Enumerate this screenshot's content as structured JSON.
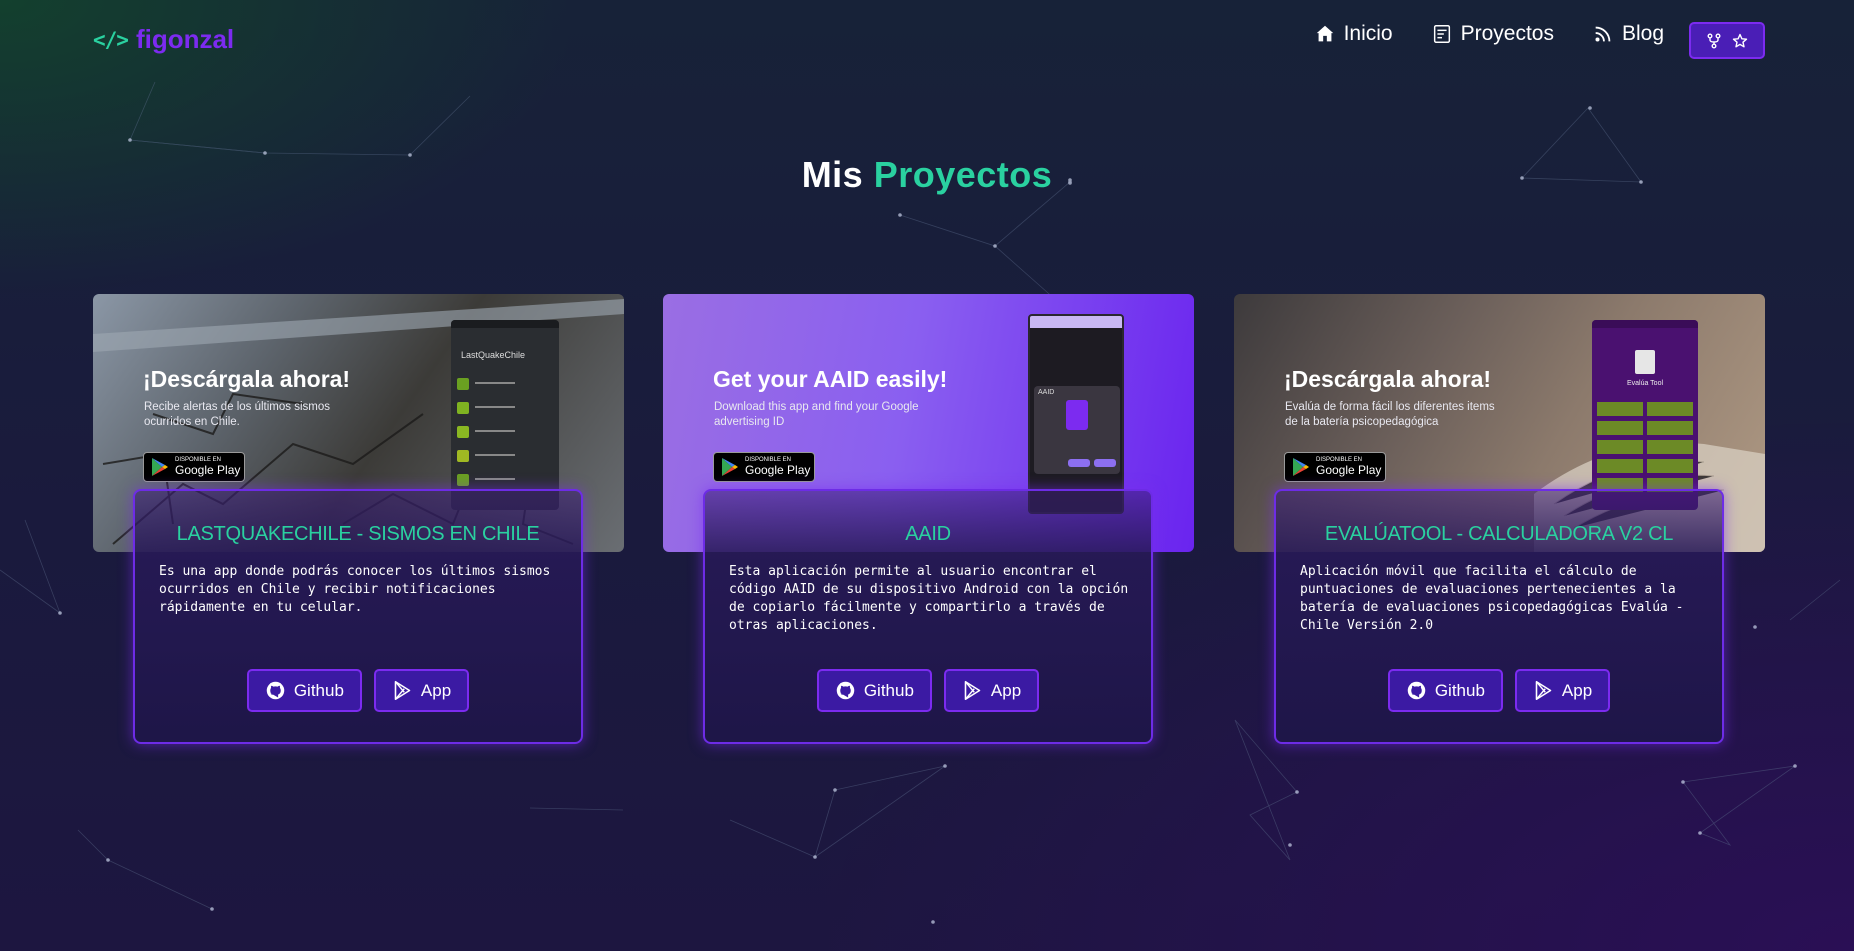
{
  "nav": {
    "logo_icon": "</>",
    "logo_text": "figonzal",
    "links": [
      {
        "label": "Inicio",
        "icon": "home-icon"
      },
      {
        "label": "Proyectos",
        "icon": "projects-icon"
      },
      {
        "label": "Blog",
        "icon": "rss-icon"
      }
    ],
    "repo_button_icons": [
      "fork-icon",
      "star-icon"
    ]
  },
  "page": {
    "title_part1": "Mis",
    "title_part2": "Proyectos"
  },
  "colors": {
    "accent_green": "#2ad1a0",
    "accent_purple": "#7c2bf0",
    "button_bg": "#3b1aa3"
  },
  "projects": [
    {
      "banner_headline": "¡Descárgala ahora!",
      "banner_sub": "Recibe alertas de los últimos sismos ocurridos en Chile.",
      "badge_small": "DISPONIBLE EN",
      "badge_big": "Google Play",
      "phone_app_title": "LastQuakeChile",
      "title": "LASTQUAKECHILE - SISMOS EN CHILE",
      "description": "Es una app donde podrás conocer los últimos sismos ocurridos en Chile y recibir notificaciones rápidamente en tu celular.",
      "github_label": "Github",
      "app_label": "App"
    },
    {
      "banner_headline": "Get your AAID easily!",
      "banner_sub": "Download this app and find your Google advertising ID",
      "badge_small": "DISPONIBLE EN",
      "badge_big": "Google Play",
      "phone_app_title": "AAID",
      "title": "AAID",
      "description": "Esta aplicación permite al usuario encontrar el código AAID de su dispositivo Android con la opción de copiarlo fácilmente y compartirlo a través de otras aplicaciones.",
      "github_label": "Github",
      "app_label": "App"
    },
    {
      "banner_headline": "¡Descárgala ahora!",
      "banner_sub": "Evalúa de forma fácil los diferentes items de la batería psicopedagógica",
      "badge_small": "DISPONIBLE EN",
      "badge_big": "Google Play",
      "phone_app_title": "Evalúa Tool",
      "title": "EVALÚATOOL - CALCULADORA V2 CL",
      "description": "Aplicación móvil que facilita el cálculo de puntuaciones de evaluaciones pertenecientes a la batería de evaluaciones psicopedagógicas Evalúa - Chile Versión 2.0",
      "github_label": "Github",
      "app_label": "App"
    }
  ]
}
